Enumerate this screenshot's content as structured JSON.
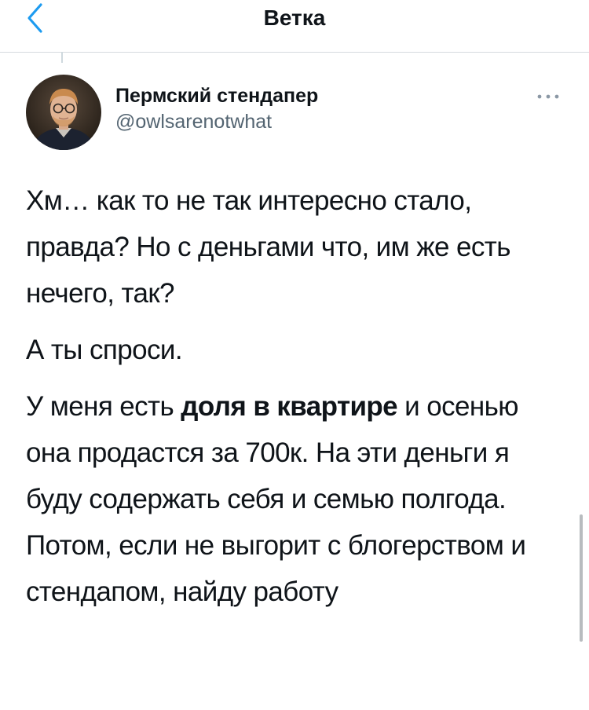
{
  "header": {
    "title": "Ветка"
  },
  "author": {
    "name": "Пермский стендапер",
    "handle": "@owlsarenotwhat"
  },
  "tweet": {
    "paragraph1": "Хм… как то не так интересно стало, правда? Но с деньгами что, им же есть нечего, так?",
    "paragraph2": "А ты спроси.",
    "paragraph3_before": "У меня есть ",
    "paragraph3_bold": "доля в квартире",
    "paragraph3_after": " и осенью она продастся за 700к. На эти деньги я буду содержать себя и семью полгода. Потом, если не выгорит с блогерством и стендапом, найду работу"
  },
  "colors": {
    "accent": "#1d9bf0",
    "text": "#0f1419",
    "secondary_text": "#536471"
  },
  "icons": {
    "back": "chevron-left-icon",
    "more": "more-horizontal-icon"
  }
}
